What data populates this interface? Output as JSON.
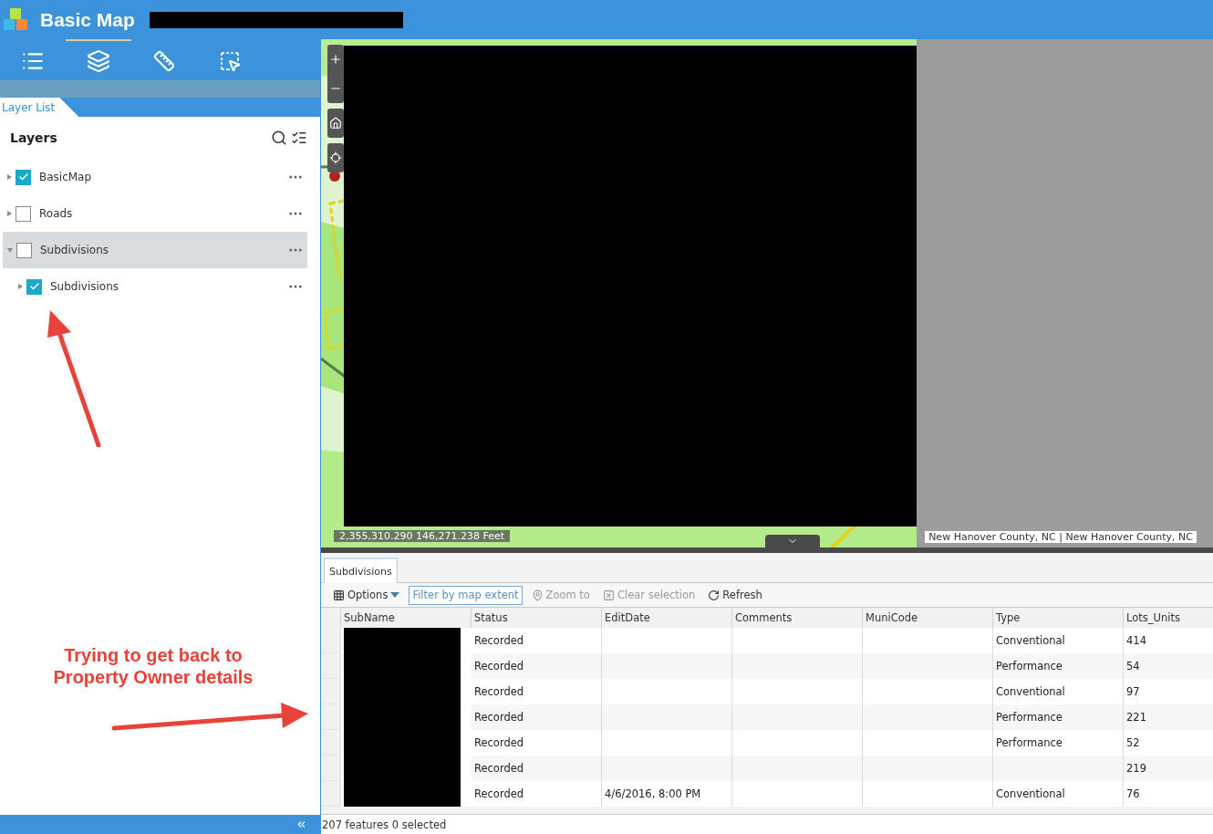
{
  "header": {
    "title": "Basic Map"
  },
  "toolbar": [
    {
      "kind": "legend",
      "selected": false
    },
    {
      "kind": "layers",
      "selected": true
    },
    {
      "kind": "measure",
      "selected": false
    },
    {
      "kind": "select",
      "selected": false
    }
  ],
  "panel_tab": "Layer List",
  "layers": {
    "title": "Layers",
    "items": [
      {
        "label": "BasicMap",
        "checked": true,
        "expanded": false,
        "selected": false
      },
      {
        "label": "Roads",
        "checked": false,
        "expanded": false,
        "selected": false
      },
      {
        "label": "Subdivisions",
        "checked": false,
        "expanded": true,
        "selected": true,
        "children": [
          {
            "label": "Subdivisions",
            "checked": true,
            "expanded": false,
            "selected": false
          }
        ]
      }
    ]
  },
  "map": {
    "coordinates": "2,355,310.290 146,271.238 Feet",
    "attribution": "New Hanover County, NC | New Hanover County, NC"
  },
  "table": {
    "tab": "Subdivisions",
    "toolbar": [
      {
        "kind": "options",
        "label": "Options",
        "disabled": false
      },
      {
        "kind": "filter",
        "label": "Filter by map extent",
        "disabled": false
      },
      {
        "kind": "zoom",
        "label": "Zoom to",
        "disabled": true
      },
      {
        "kind": "clear",
        "label": "Clear selection",
        "disabled": true
      },
      {
        "kind": "refresh",
        "label": "Refresh",
        "disabled": false
      }
    ],
    "columns": [
      "SubName",
      "Status",
      "EditDate",
      "Comments",
      "MuniCode",
      "Type",
      "Lots_Units"
    ],
    "rows": [
      {
        "status": "Recorded",
        "type": "Conventional",
        "lots_units": "414"
      },
      {
        "status": "Recorded",
        "type": "Performance",
        "lots_units": "54"
      },
      {
        "status": "Recorded",
        "type": "Conventional",
        "lots_units": "97"
      },
      {
        "status": "Recorded",
        "type": "Performance",
        "lots_units": "221"
      },
      {
        "status": "Recorded",
        "type": "Performance",
        "lots_units": "52"
      },
      {
        "status": "Recorded",
        "lots_units": "219"
      },
      {
        "status": "Recorded",
        "edit_date": "4/6/2016, 8:00 PM",
        "type": "Conventional",
        "lots_units": "76"
      }
    ]
  },
  "status_bar": "207 features 0 selected",
  "annotation": "Trying to get back to Property Owner details"
}
